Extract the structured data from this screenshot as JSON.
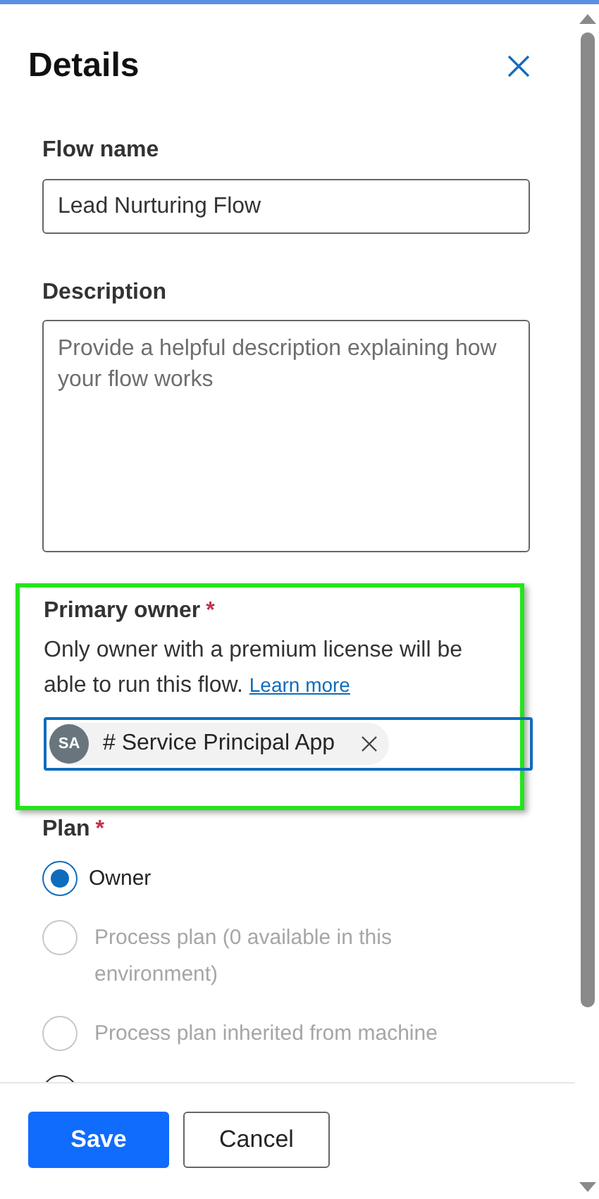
{
  "panel": {
    "title": "Details"
  },
  "flow_name": {
    "label": "Flow name",
    "value": "Lead Nurturing Flow"
  },
  "description": {
    "label": "Description",
    "placeholder": "Provide a helpful description explaining how your flow works"
  },
  "primary_owner": {
    "label": "Primary owner",
    "required_mark": "*",
    "highlighted": true,
    "help_text": "Only owner with a premium license will be able to run this flow.",
    "link": "Learn more",
    "owner_tag": {
      "initials": "SA",
      "name": "# Service Principal App"
    }
  },
  "plan": {
    "label": "Plan",
    "required_mark": "*",
    "options": [
      {
        "label": "Owner",
        "selected": true,
        "disabled": false
      },
      {
        "label": "Process plan (0 available in this environment)",
        "selected": false,
        "disabled": true
      },
      {
        "label": "Process plan inherited from machine",
        "selected": false,
        "disabled": true
      },
      {
        "selected": false,
        "disabled": false
      }
    ]
  },
  "buttons": [
    {
      "kind": "primary",
      "label": "Save"
    },
    {
      "kind": "secondary",
      "label": "Cancel"
    }
  ]
}
